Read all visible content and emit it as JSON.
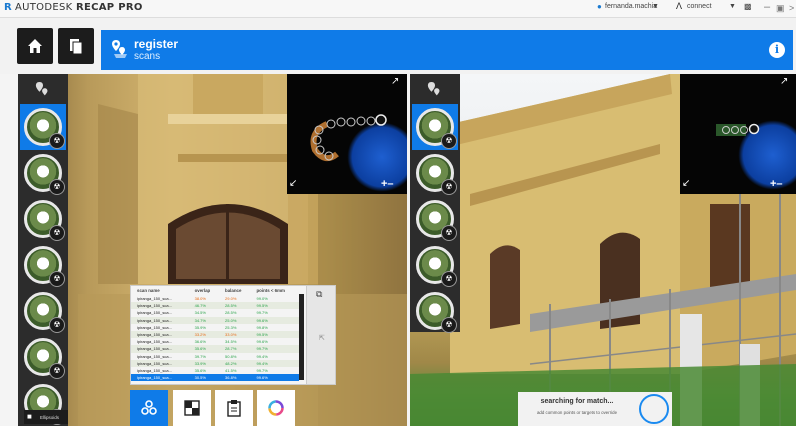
{
  "titlebar": {
    "brand": "AUTODESK",
    "product": "RECAP PRO",
    "user_label": "fernanda.machia",
    "connect_label": "connect"
  },
  "header": {
    "title": "register",
    "subtitle": "scans"
  },
  "scan_table": {
    "columns": [
      "scan name",
      "overlap",
      "balance",
      "points < 6mm"
    ],
    "rows": [
      {
        "name": "ipiranga_150_sca...",
        "overlap": "38.0%",
        "balance": "29.0%",
        "points": "99.0%",
        "status": "warn"
      },
      {
        "name": "ipiranga_150_sca...",
        "overlap": "46.7%",
        "balance": "28.5%",
        "points": "99.5%",
        "status": "ok"
      },
      {
        "name": "ipiranga_150_sca...",
        "overlap": "34.5%",
        "balance": "28.5%",
        "points": "99.7%",
        "status": "ok"
      },
      {
        "name": "ipiranga_150_sca...",
        "overlap": "34.7%",
        "balance": "25.0%",
        "points": "99.6%",
        "status": "ok"
      },
      {
        "name": "ipiranga_150_sca...",
        "overlap": "35.9%",
        "balance": "25.3%",
        "points": "99.8%",
        "status": "ok"
      },
      {
        "name": "ipiranga_150_sca...",
        "overlap": "33.2%",
        "balance": "33.0%",
        "points": "99.5%",
        "status": "warn"
      },
      {
        "name": "ipiranga_150_sca...",
        "overlap": "36.6%",
        "balance": "34.5%",
        "points": "99.6%",
        "status": "ok"
      },
      {
        "name": "ipiranga_150_sca...",
        "overlap": "35.6%",
        "balance": "28.7%",
        "points": "99.7%",
        "status": "ok"
      },
      {
        "name": "ipiranga_150_sca...",
        "overlap": "39.7%",
        "balance": "50.8%",
        "points": "99.4%",
        "status": "ok"
      },
      {
        "name": "ipiranga_150_sca...",
        "overlap": "33.9%",
        "balance": "48.2%",
        "points": "99.4%",
        "status": "ok"
      },
      {
        "name": "ipiranga_150_sca...",
        "overlap": "35.6%",
        "balance": "41.5%",
        "points": "99.7%",
        "status": "ok"
      },
      {
        "name": "ipiranga_150_sca...",
        "overlap": "30.5%",
        "balance": "36.8%",
        "points": "99.6%",
        "status": "selected"
      }
    ]
  },
  "search_panel": {
    "title": "searching for match...",
    "hint": "add common points or targets to override"
  },
  "left_panel": {
    "scan_badge": "Ellipsoids"
  },
  "colors": {
    "accent": "#0f7be8",
    "dark": "#2c2c2c",
    "ok": "#2aa34a",
    "warn": "#e86a14"
  },
  "icons": {
    "home": "home-icon",
    "pages": "pages-icon",
    "register": "register-scans-icon",
    "info": "info-icon",
    "expand": "expand-icon",
    "collapse": "collapse-icon",
    "zoom": "zoom-plus-minus-icon",
    "scans": "scans-cluster-icon",
    "checker": "checker-icon",
    "clipboard": "clipboard-icon",
    "color": "color-wheel-icon"
  }
}
